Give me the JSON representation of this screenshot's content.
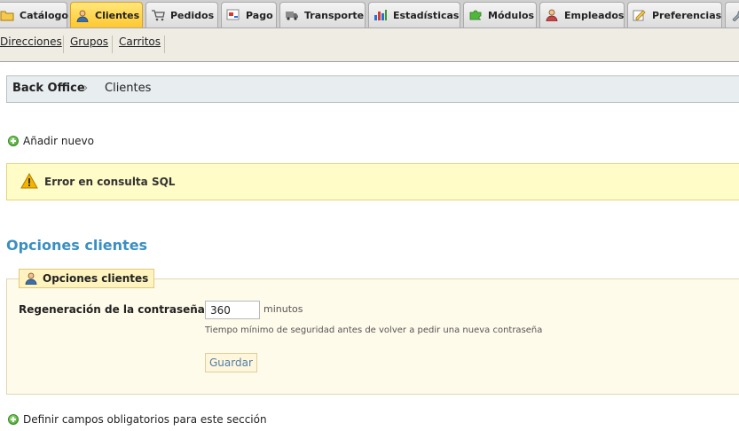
{
  "tabs": [
    {
      "label": "Catálogo",
      "icon": "folder-icon",
      "active": false
    },
    {
      "label": "Clientes",
      "icon": "customer-icon",
      "active": true
    },
    {
      "label": "Pedidos",
      "icon": "cart-icon",
      "active": false
    },
    {
      "label": "Pago",
      "icon": "payment-icon",
      "active": false
    },
    {
      "label": "Transporte",
      "icon": "truck-icon",
      "active": false
    },
    {
      "label": "Estadísticas",
      "icon": "bar-chart-icon",
      "active": false
    },
    {
      "label": "Módulos",
      "icon": "puzzle-icon",
      "active": false
    },
    {
      "label": "Empleados",
      "icon": "employee-icon",
      "active": false
    },
    {
      "label": "Preferencias",
      "icon": "preferences-icon",
      "active": false
    }
  ],
  "submenu": {
    "items": [
      "Direcciones",
      "Grupos",
      "Carritos"
    ]
  },
  "breadcrumb": {
    "root": "Back Office",
    "separator": "›",
    "current": "Clientes"
  },
  "actions": {
    "add_new": "Añadir nuevo",
    "define_required": "Definir campos obligatorios para este sección"
  },
  "warning": {
    "text": "Error en consulta SQL"
  },
  "options": {
    "title": "Opciones clientes",
    "legend": "Opciones clientes",
    "field_label": "Regeneración de la contraseña",
    "field_value": "360",
    "unit": "minutos",
    "help": "Tiempo mínimo de seguridad antes de volver a pedir una nueva contraseña",
    "save_label": "Guardar"
  },
  "colors": {
    "active_tab": "#ffc62d",
    "section_title": "#3a8fc2",
    "warning_bg": "#fffcc8"
  }
}
